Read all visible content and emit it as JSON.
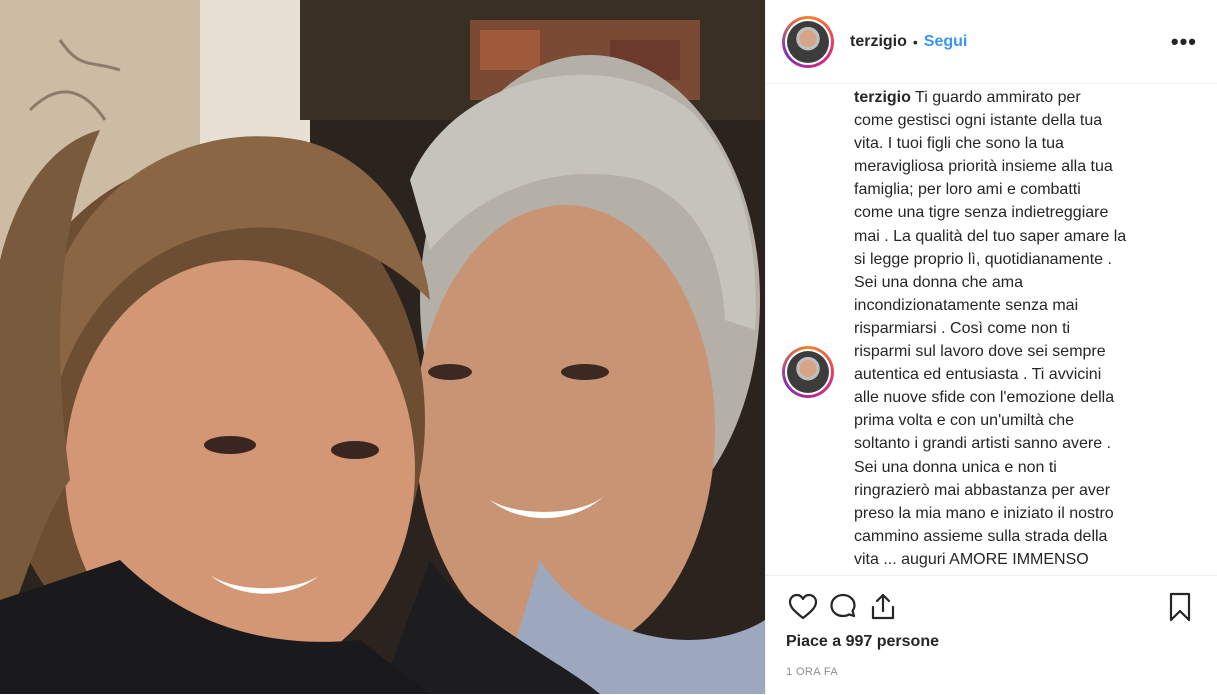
{
  "post": {
    "username": "terzigio",
    "separator": "•",
    "follow_label": "Segui",
    "more_label": "•••",
    "caption_user": "terzigio",
    "caption_lines": [
      "Ti guardo ammirato per",
      "come gestisci ogni istante della tua",
      "vita. I tuoi figli che sono la tua",
      "meravigliosa priorità insieme alla tua",
      "famiglia; per loro ami e combatti",
      "come una tigre senza indietreggiare",
      "mai . La qualità del tuo saper amare la",
      "si legge proprio lì, quotidianamente .",
      "Sei una donna che ama",
      "incondizionatamente senza mai",
      "risparmiarsi . Così come non ti",
      "risparmi sul lavoro dove sei sempre",
      "autentica ed entusiasta . Ti avvicini",
      "alle nuove sfide con l'emozione della",
      "prima volta e con un'umiltà che",
      "soltanto i grandi artisti sanno avere .",
      "Sei una donna unica e non ti",
      "ringrazierò mai abbastanza per aver",
      "preso la mia mano e iniziato il nostro",
      "cammino assieme sulla strada della",
      "vita ... auguri AMORE IMMENSO"
    ],
    "likes_text": "Piace a 997 persone",
    "timestamp": "1 ORA FA"
  },
  "icons": [
    "heart-icon",
    "comment-icon",
    "share-icon",
    "bookmark-icon"
  ]
}
